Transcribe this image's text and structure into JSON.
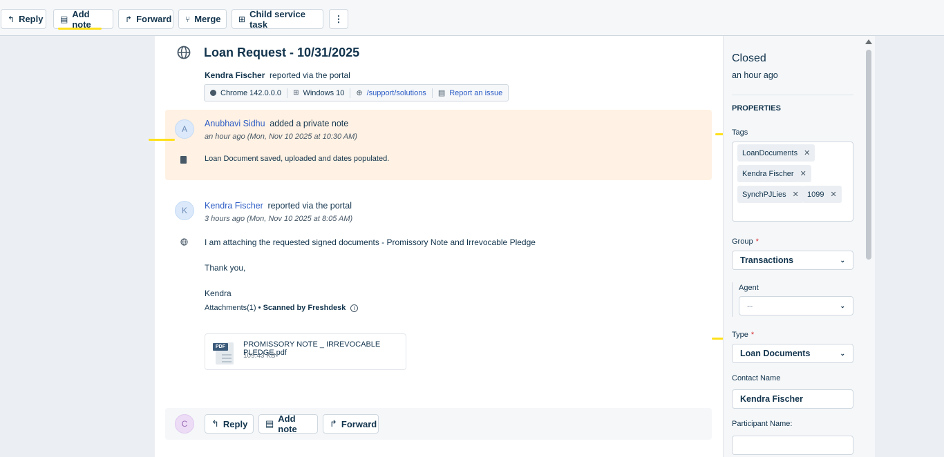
{
  "toolbar": {
    "reply": "Reply",
    "add_note": "Add note",
    "forward": "Forward",
    "merge": "Merge",
    "child_task": "Child service task",
    "more": "⋮"
  },
  "ticket": {
    "title": "Loan Request - 10/31/2025",
    "requester": "Kendra Fischer",
    "reported_via": "reported via the portal",
    "browser": "Chrome 142.0.0.0",
    "os": "Windows 10",
    "page": "/support/solutions",
    "report_issue": "Report an issue"
  },
  "note": {
    "avatar": "A",
    "author": "Anubhavi Sidhu",
    "action": "added a private note",
    "time": "an hour ago (Mon, Nov 10 2025 at 10:30 AM)",
    "body": "Loan Document saved, uploaded and dates populated."
  },
  "message": {
    "avatar": "K",
    "author": "Kendra Fischer",
    "action": "reported via the portal",
    "time": "3 hours ago (Mon, Nov 10 2025 at 8:05 AM)",
    "line1": "I am attaching the requested signed documents - Promissory Note and Irrevocable Pledge",
    "line2": "Thank you,",
    "line3": "Kendra",
    "attachments_label": "Attachments(1)",
    "scanned_label": "• Scanned by Freshdesk",
    "file_name": "PROMISSORY NOTE _ IRREVOCABLE PLEDGE.pdf",
    "file_size": "109.43 KB",
    "file_badge": "PDF"
  },
  "reply_bar": {
    "avatar": "C",
    "reply": "Reply",
    "add_note": "Add note",
    "forward": "Forward"
  },
  "properties": {
    "status": "Closed",
    "status_time": "an hour ago",
    "section_title": "PROPERTIES",
    "tags_label": "Tags",
    "tags": [
      "LoanDocuments",
      "Kendra Fischer",
      "SynchPJLies",
      "1099"
    ],
    "group_label": "Group",
    "group_value": "Transactions",
    "agent_label": "Agent",
    "agent_value": "--",
    "type_label": "Type",
    "type_value": "Loan Documents",
    "contact_label": "Contact Name",
    "contact_value": "Kendra Fischer",
    "participant_label": "Participant Name:",
    "participant_value": "",
    "required_mark": "*"
  },
  "colors": {
    "highlight": "#ffe01a",
    "note_bg": "#fff1e3",
    "link": "#2c5cc5",
    "required": "#d72d30"
  }
}
